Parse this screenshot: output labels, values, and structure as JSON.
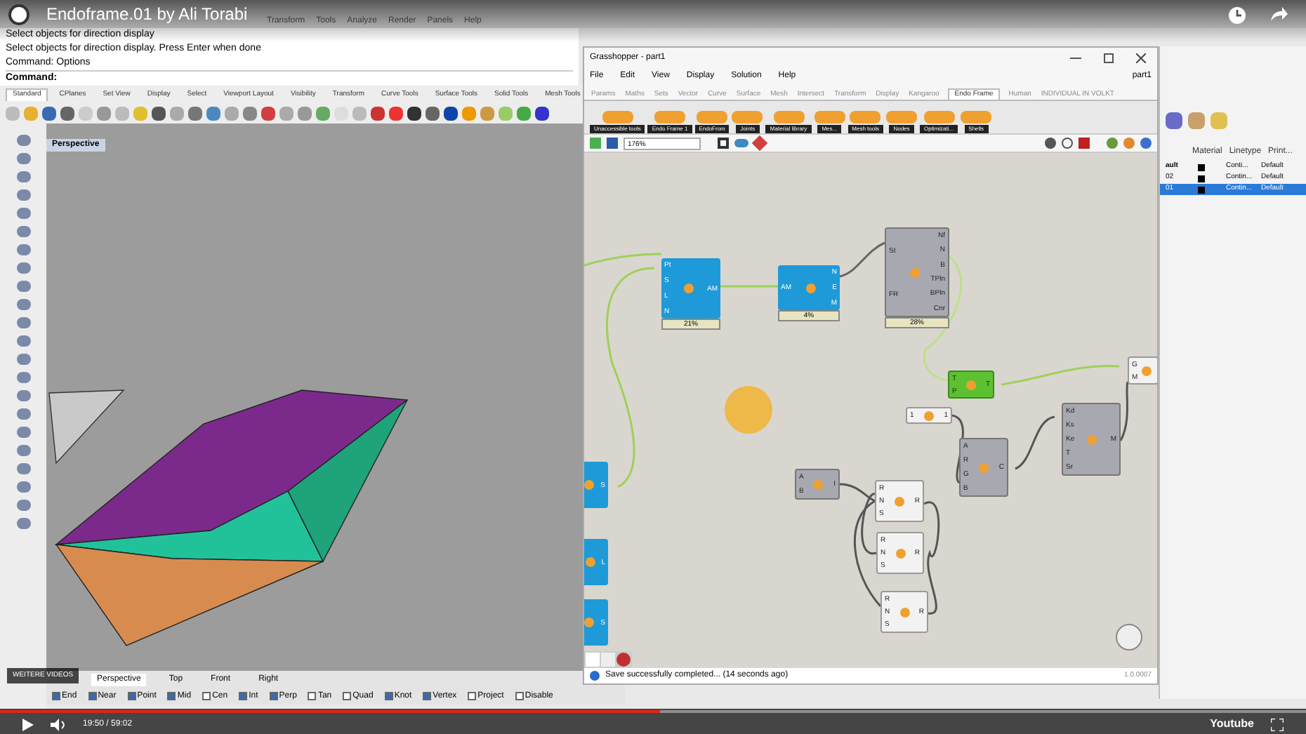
{
  "video": {
    "title": "Endoframe.01 by Ali Torabi",
    "more_videos": "WEITERE VIDEOS",
    "time": "19:50 / 59:02",
    "progress": {
      "level": 0.505
    },
    "brand": "Youtube"
  },
  "rhino": {
    "menu": [
      "Transform",
      "Tools",
      "Analyze",
      "Render",
      "Panels",
      "Help"
    ],
    "command_history": [
      "Select objects for direction display",
      "Select objects for direction display. Press Enter when done",
      "Command: Options"
    ],
    "command_prompt": "Command:",
    "toolbar_tabs": [
      {
        "label": "Standard",
        "selected": true
      },
      {
        "label": "CPlanes",
        "selected": false
      },
      {
        "label": "Set View",
        "selected": false
      },
      {
        "label": "Display",
        "selected": false
      },
      {
        "label": "Select",
        "selected": false
      },
      {
        "label": "Viewport Layout",
        "selected": false
      },
      {
        "label": "Visibility",
        "selected": false
      },
      {
        "label": "Transform",
        "selected": false
      },
      {
        "label": "Curve Tools",
        "selected": false
      },
      {
        "label": "Surface Tools",
        "selected": false
      },
      {
        "label": "Solid Tools",
        "selected": false
      },
      {
        "label": "Mesh Tools",
        "selected": false
      }
    ],
    "viewport": {
      "label": "Perspective"
    },
    "viewport_tabs": [
      {
        "label": "Perspective",
        "selected": true
      },
      {
        "label": "Top",
        "selected": false
      },
      {
        "label": "Front",
        "selected": false
      },
      {
        "label": "Right",
        "selected": false
      }
    ],
    "osnaps": [
      {
        "label": "End",
        "checked": true
      },
      {
        "label": "Near",
        "checked": true
      },
      {
        "label": "Point",
        "checked": true
      },
      {
        "label": "Mid",
        "checked": true
      },
      {
        "label": "Cen",
        "checked": false
      },
      {
        "label": "Int",
        "checked": true
      },
      {
        "label": "Perp",
        "checked": true
      },
      {
        "label": "Tan",
        "checked": false
      },
      {
        "label": "Quad",
        "checked": false
      },
      {
        "label": "Knot",
        "checked": true
      },
      {
        "label": "Vertex",
        "checked": true
      },
      {
        "label": "Project",
        "checked": false
      },
      {
        "label": "Disable",
        "checked": false
      }
    ]
  },
  "grasshopper": {
    "title": "Grasshopper - part1",
    "menu": [
      "File",
      "Edit",
      "View",
      "Display",
      "Solution",
      "Help"
    ],
    "document": "part1",
    "tabs": [
      {
        "label": "Params",
        "selected": false
      },
      {
        "label": "Maths",
        "selected": false
      },
      {
        "label": "Sets",
        "selected": false
      },
      {
        "label": "Vector",
        "selected": false
      },
      {
        "label": "Curve",
        "selected": false
      },
      {
        "label": "Surface",
        "selected": false
      },
      {
        "label": "Mesh",
        "selected": false
      },
      {
        "label": "Intersect",
        "selected": false
      },
      {
        "label": "Transform",
        "selected": false
      },
      {
        "label": "Display",
        "selected": false
      },
      {
        "label": "Kangaroo",
        "selected": false
      },
      {
        "label": "Endo Frame",
        "selected": true
      },
      {
        "label": "Human",
        "selected": false
      },
      {
        "label": "INDIVIDUAL IN VOLKT",
        "selected": false
      }
    ],
    "groups": [
      "Unaccessible tools",
      "Endo Frame 1",
      "EndoFrom",
      "Joints",
      "Material library",
      "Mes...",
      "Mesh tools",
      "Nodes",
      "Optimizati...",
      "Shells"
    ],
    "zoom": "176%",
    "components": [
      {
        "kind": "blue",
        "inputs": [
          "Pt",
          "S",
          "L",
          "N"
        ],
        "outputs": [
          "AM"
        ],
        "footer": "21%"
      },
      {
        "kind": "blue",
        "inputs": [
          "AM"
        ],
        "outputs": [
          "N",
          "E",
          "M"
        ],
        "footer": "4%"
      },
      {
        "kind": "grey",
        "inputs": [
          "St",
          "FR"
        ],
        "outputs": [
          "Nf",
          "N",
          "B",
          "TPln",
          "BPln",
          "Cnr"
        ],
        "footer": "28%"
      },
      {
        "kind": "green",
        "inputs": [
          "T",
          "P"
        ],
        "outputs": [
          "T"
        ]
      },
      {
        "kind": "white",
        "inputs": [
          "1"
        ],
        "outputs": [
          "1"
        ]
      },
      {
        "kind": "grey",
        "inputs": [
          "A",
          "R",
          "G",
          "B"
        ],
        "outputs": [
          "C"
        ]
      },
      {
        "kind": "grey",
        "inputs": [
          "Kd",
          "Ks",
          "Ke",
          "T",
          "Sr"
        ],
        "outputs": [
          "M"
        ]
      },
      {
        "kind": "white",
        "inputs": [
          "G",
          "M"
        ]
      },
      {
        "kind": "grey",
        "inputs": [
          "A",
          "B"
        ],
        "outputs": [
          "I"
        ]
      },
      {
        "kind": "white",
        "inputs": [
          "R",
          "N",
          "S"
        ],
        "outputs": [
          "R"
        ]
      },
      {
        "kind": "white",
        "inputs": [
          "R",
          "N",
          "S"
        ],
        "outputs": [
          "R"
        ]
      },
      {
        "kind": "white",
        "inputs": [
          "R",
          "N",
          "S"
        ],
        "outputs": [
          "R"
        ]
      },
      {
        "kind": "blue",
        "outputs": [
          "S"
        ]
      },
      {
        "kind": "blue",
        "outputs": [
          "L"
        ]
      },
      {
        "kind": "blue",
        "outputs": [
          "S"
        ]
      }
    ],
    "status": "Save successfully completed... (14 seconds ago)",
    "version": "1.0.0007"
  },
  "layers": {
    "columns": [
      "Material",
      "Linetype",
      "Print..."
    ],
    "rows": [
      {
        "name": "ault",
        "linetype": "Conti...",
        "print": "Default",
        "selected": false
      },
      {
        "name": "02",
        "linetype": "Contin...",
        "print": "Default",
        "selected": false
      },
      {
        "name": "01",
        "linetype": "Contin...",
        "print": "Default",
        "selected": true
      }
    ]
  }
}
